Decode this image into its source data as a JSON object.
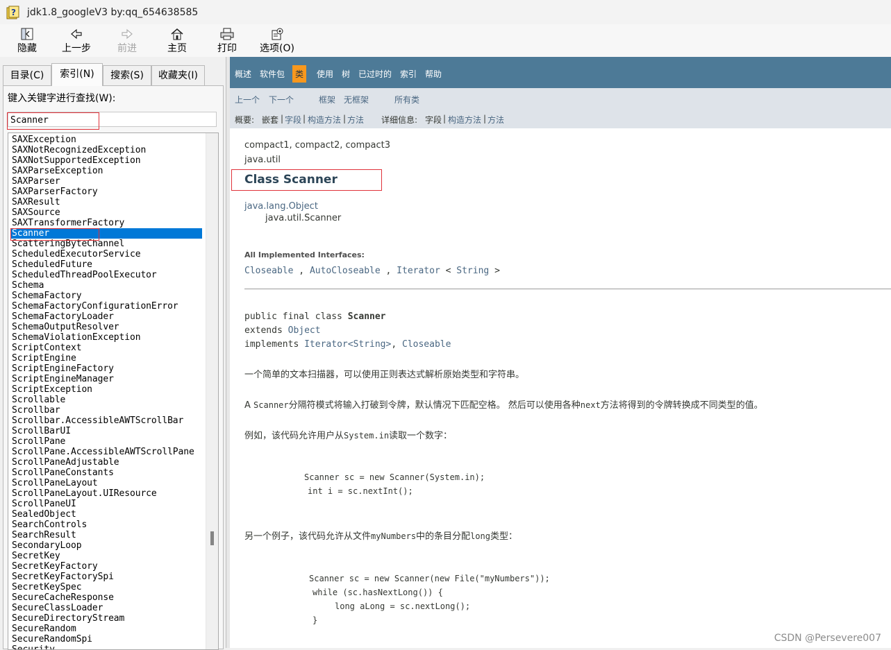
{
  "window": {
    "title": "jdk1.8_googleV3 by:qq_654638585"
  },
  "toolbar": {
    "hide": "隐藏",
    "back": "上一步",
    "forward": "前进",
    "home": "主页",
    "print": "打印",
    "options": "选项(O)"
  },
  "tabs": {
    "contents": "目录(C)",
    "index": "索引(N)",
    "search": "搜索(S)",
    "favorites": "收藏夹(I)"
  },
  "index_panel": {
    "keyword_label": "键入关键字进行查找(W):",
    "search_value": "Scanner",
    "items": [
      "SAXException",
      "SAXNotRecognizedException",
      "SAXNotSupportedException",
      "SAXParseException",
      "SAXParser",
      "SAXParserFactory",
      "SAXResult",
      "SAXSource",
      "SAXTransformerFactory",
      "Scanner",
      "ScatteringByteChannel",
      "ScheduledExecutorService",
      "ScheduledFuture",
      "ScheduledThreadPoolExecutor",
      "Schema",
      "SchemaFactory",
      "SchemaFactoryConfigurationError",
      "SchemaFactoryLoader",
      "SchemaOutputResolver",
      "SchemaViolationException",
      "ScriptContext",
      "ScriptEngine",
      "ScriptEngineFactory",
      "ScriptEngineManager",
      "ScriptException",
      "Scrollable",
      "Scrollbar",
      "Scrollbar.AccessibleAWTScrollBar",
      "ScrollBarUI",
      "ScrollPane",
      "ScrollPane.AccessibleAWTScrollPane",
      "ScrollPaneAdjustable",
      "ScrollPaneConstants",
      "ScrollPaneLayout",
      "ScrollPaneLayout.UIResource",
      "ScrollPaneUI",
      "SealedObject",
      "SearchControls",
      "SearchResult",
      "SecondaryLoop",
      "SecretKey",
      "SecretKeyFactory",
      "SecretKeyFactorySpi",
      "SecretKeySpec",
      "SecureCacheResponse",
      "SecureClassLoader",
      "SecureDirectoryStream",
      "SecureRandom",
      "SecureRandomSpi",
      "Security"
    ],
    "selected_item": "Scanner"
  },
  "navbar": {
    "items": [
      "概述",
      "软件包",
      "类",
      "使用",
      "树",
      "已过时的",
      "索引",
      "帮助"
    ],
    "active": "类"
  },
  "subnav": {
    "prev": "上一个",
    "next": "下一个",
    "frames": "框架",
    "noframes": "无框架",
    "allclasses": "所有类",
    "summary_label": "概要:",
    "summary_nested": "嵌套",
    "summary_field": "字段",
    "summary_constr": "构造方法",
    "summary_method": "方法",
    "detail_label": "详细信息:",
    "detail_field": "字段",
    "detail_constr": "构造方法",
    "detail_method": "方法",
    "sep": "|"
  },
  "doc": {
    "profiles": "compact1, compact2, compact3",
    "package": "java.util",
    "class_title": "Class Scanner",
    "hierarchy_parent": "java.lang.Object",
    "hierarchy_child": "java.util.Scanner",
    "interfaces_label": "All Implemented Interfaces:",
    "interfaces": [
      "Closeable",
      "AutoCloseable",
      "Iterator",
      "String"
    ],
    "interfaces_sep": ",",
    "interfaces_lt": "<",
    "interfaces_gt": ">",
    "decl_prefix": "public final class",
    "decl_name": "Scanner",
    "extends_kw": "extends",
    "extends_target": "Object",
    "implements_kw": "implements",
    "implements_iter": "Iterator<String>",
    "implements_sep": ",",
    "implements_close": "Closeable",
    "para1": "一个简单的文本扫描器，可以使用正则表达式解析原始类型和字符串。",
    "para2_a": "A",
    "para2_code1": "Scanner",
    "para2_b": "分隔符模式将输入打破到令牌，默认情况下匹配空格。 然后可以使用各种",
    "para2_code2": "next",
    "para2_c": "方法将得到的令牌转换成不同类型的值。",
    "para3_a": "例如，该代码允许用户从",
    "para3_code": "System.in",
    "para3_b": "读取一个数字：",
    "code1_line1": "Scanner sc = new Scanner(System.in);",
    "code1_line2": "int i = sc.nextInt();",
    "para4_a": "另一个例子，该代码允许从文件",
    "para4_code1": "myNumbers",
    "para4_b": "中的条目分配",
    "para4_code2": "long",
    "para4_c": "类型：",
    "code2_line1": "Scanner sc = new Scanner(new File(\"myNumbers\"));",
    "code2_line2": "while (sc.hasNextLong()) {",
    "code2_line3": "long aLong = sc.nextLong();",
    "code2_line4": "}"
  },
  "watermark": "CSDN @Persevere007",
  "colors": {
    "navbar_bg": "#4d7a97",
    "navbar_active": "#f8981d",
    "subnav_bg": "#dee3e9",
    "link": "#4a6782",
    "selection": "#0078d7",
    "highlight_box": "#e0323a"
  }
}
